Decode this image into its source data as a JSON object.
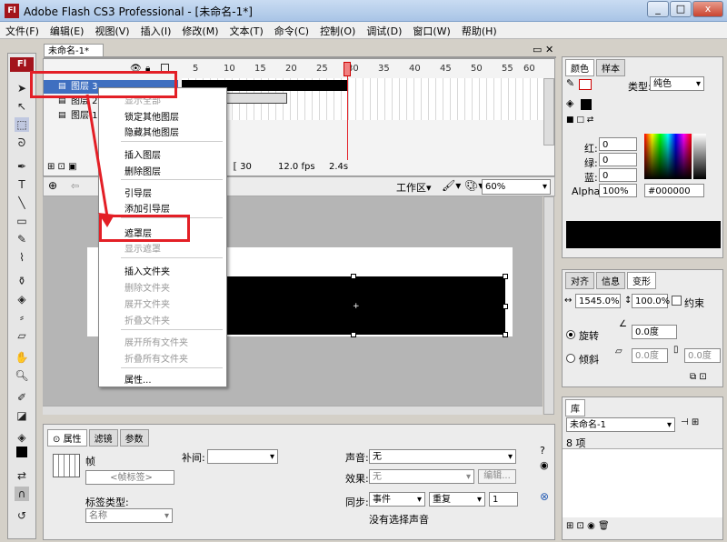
{
  "window": {
    "title": "Adobe Flash CS3 Professional - [未命名-1*]",
    "min": "_",
    "max": "□",
    "close": "x"
  },
  "menu": [
    "文件(F)",
    "编辑(E)",
    "视图(V)",
    "插入(I)",
    "修改(M)",
    "文本(T)",
    "命令(C)",
    "控制(O)",
    "调试(D)",
    "窗口(W)",
    "帮助(H)"
  ],
  "doc_tab": "未命名-1*",
  "timeline": {
    "ruler": [
      "5",
      "10",
      "15",
      "20",
      "25",
      "30",
      "35",
      "40",
      "45",
      "50",
      "55",
      "60"
    ],
    "layers": [
      "图层 3",
      "图层 2",
      "图层 1"
    ],
    "status": {
      "frame": "30",
      "fps": "12.0 fps",
      "time": "2.4s"
    }
  },
  "stagebar": {
    "workspace": "工作区▾",
    "zoom": "60%"
  },
  "context_menu": {
    "show_all": "显示全部",
    "lock_others": "锁定其他图层",
    "hide_others": "隐藏其他图层",
    "insert_layer": "插入图层",
    "delete_layer": "删除图层",
    "guide": "引导层",
    "add_motion_guide": "添加引导层",
    "mask": "遮罩层",
    "show_masking": "显示遮罩",
    "insert_folder": "插入文件夹",
    "delete_folder": "删除文件夹",
    "expand_folder": "展开文件夹",
    "collapse_folder": "折叠文件夹",
    "expand_all": "展开所有文件夹",
    "collapse_all": "折叠所有文件夹",
    "properties": "属性..."
  },
  "props": {
    "tabs": [
      "属性",
      "滤镜",
      "参数"
    ],
    "frame_label": "帧",
    "frame_name_placeholder": "<帧标签>",
    "tween_label": "补间:",
    "label_type": "标签类型:",
    "label_type_value": "名称",
    "sound_label": "声音:",
    "sound_value": "无",
    "effect_label": "效果:",
    "effect_value": "无",
    "edit_btn": "编辑...",
    "sync_label": "同步:",
    "sync_value": "事件",
    "repeat_value": "重复",
    "repeat_count": "1",
    "no_sound": "没有选择声音"
  },
  "color_panel": {
    "tabs": [
      "颜色",
      "样本"
    ],
    "type_label": "类型:",
    "type_value": "纯色",
    "red": "红:",
    "red_v": "0",
    "green": "绿:",
    "green_v": "0",
    "blue": "蓝:",
    "blue_v": "0",
    "alpha": "Alpha:",
    "alpha_v": "100%",
    "hex": "#000000"
  },
  "transform_panel": {
    "tabs": [
      "对齐",
      "信息",
      "变形"
    ],
    "width_pct": "1545.0%",
    "height_pct": "100.0%",
    "constrain": "约束",
    "rotate": "旋转",
    "rotate_v": "0.0度",
    "skew": "倾斜",
    "skew_v1": "0.0度",
    "skew_v2": "0.0度"
  },
  "library_panel": {
    "tab": "库",
    "doc": "未命名-1",
    "count": "8 项"
  },
  "colors": {
    "highlight": "#e31f26",
    "layer_select": "#3f6fc0",
    "flash_red": "#a3141c"
  }
}
